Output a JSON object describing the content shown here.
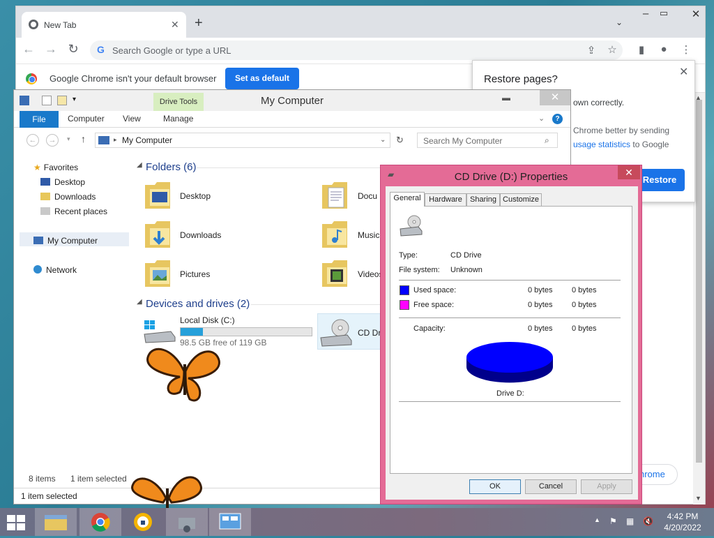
{
  "chrome": {
    "tab_title": "New Tab",
    "tab_close": "✕",
    "new_tab": "+",
    "omnibox_placeholder": "Search Google or type a URL",
    "infobar_message": "Google Chrome isn't your default browser",
    "set_default_label": "Set as default",
    "restore": {
      "title": "Restore pages?",
      "text_partial": "own correctly.",
      "body_partial_1": "Chrome better by sending",
      "body_link": "usage statistics",
      "body_partial_2": "to Google",
      "button": "Restore"
    },
    "mini_button": "hrome"
  },
  "explorer": {
    "title": "My Computer",
    "drive_tools": "Drive Tools",
    "ribbon_tabs": [
      "File",
      "Computer",
      "View",
      "Manage"
    ],
    "address": "My Computer",
    "search_placeholder": "Search My Computer",
    "nav": {
      "favorites": "Favorites",
      "desktop": "Desktop",
      "downloads": "Downloads",
      "recent": "Recent places",
      "my_computer": "My Computer",
      "network": "Network"
    },
    "folders_header": "Folders (6)",
    "folders": [
      "Desktop",
      "Downloads",
      "Pictures",
      "Docu",
      "Music",
      "Videos"
    ],
    "devices_header": "Devices and drives (2)",
    "local_disk": {
      "name": "Local Disk (C:)",
      "free": "98.5 GB free of 119 GB",
      "used_fraction": 0.17
    },
    "cd_drive_partial": "CD Dri",
    "status_items": "8 items",
    "status_selected": "1 item selected",
    "status_bottom": "1 item selected"
  },
  "properties": {
    "title": "CD Drive (D:) Properties",
    "tabs": [
      "General",
      "Hardware",
      "Sharing",
      "Customize"
    ],
    "type_label": "Type:",
    "type_value": "CD Drive",
    "fs_label": "File system:",
    "fs_value": "Unknown",
    "used_label": "Used space:",
    "used_bytes": "0 bytes",
    "used_bytes2": "0 bytes",
    "free_label": "Free space:",
    "free_bytes": "0 bytes",
    "free_bytes2": "0 bytes",
    "capacity_label": "Capacity:",
    "capacity_bytes": "0 bytes",
    "capacity_bytes2": "0 bytes",
    "drive_label": "Drive D:",
    "used_color": "#0000ff",
    "free_color": "#ff00ff",
    "ok": "OK",
    "cancel": "Cancel",
    "apply": "Apply"
  },
  "taskbar": {
    "time": "4:42 PM",
    "date": "4/20/2022",
    "tray_arrow": "▲"
  }
}
